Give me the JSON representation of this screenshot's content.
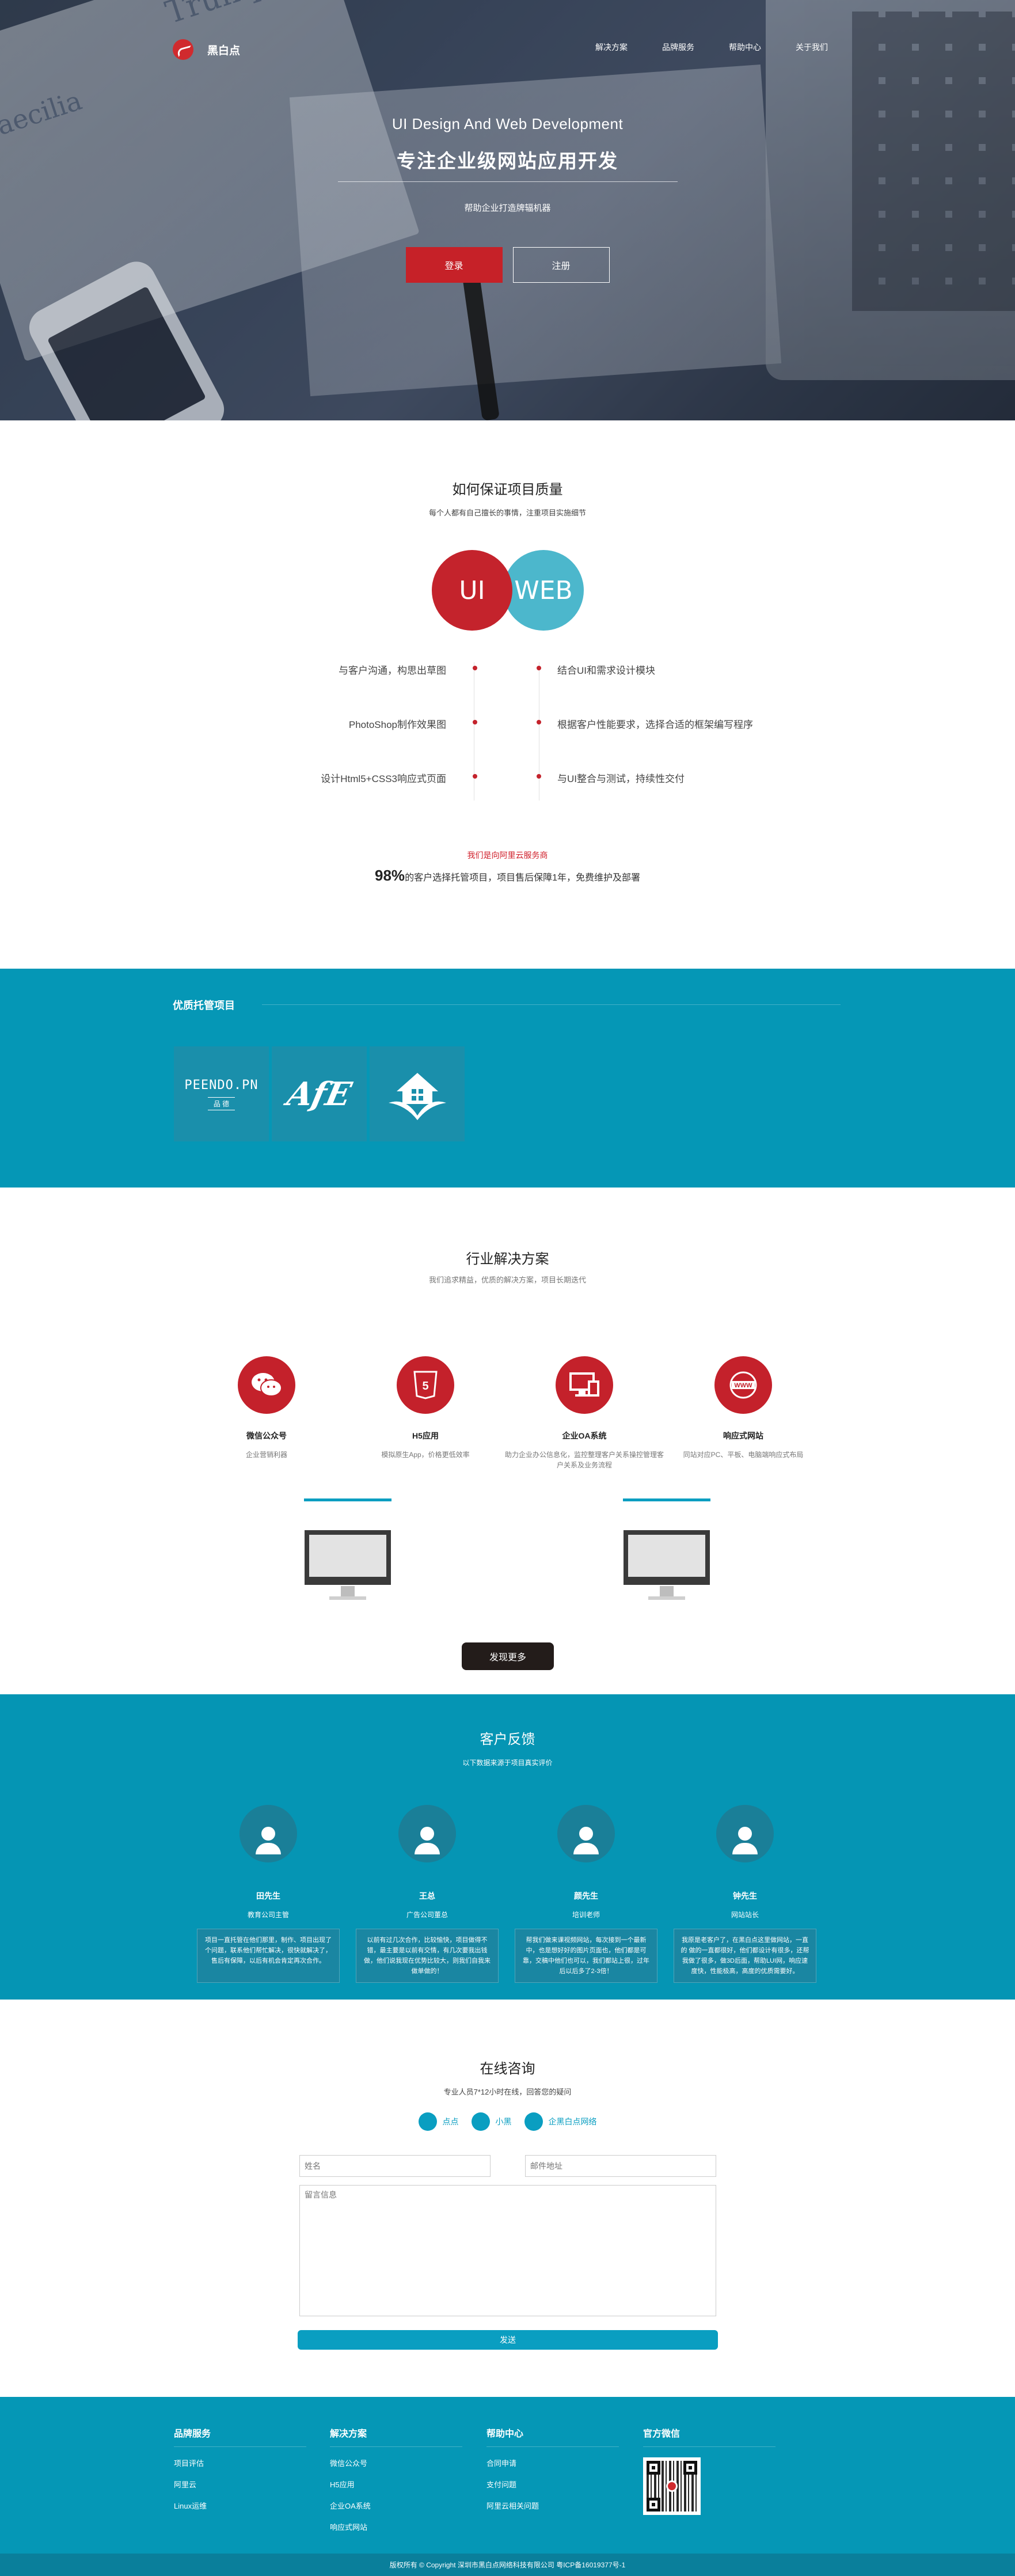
{
  "nav": {
    "logo_text": "黑白点",
    "links": [
      "解决方案",
      "品牌服务",
      "帮助中心",
      "关于我们"
    ]
  },
  "hero": {
    "title_en": "UI Design And Web Development",
    "title_zh": "专注企业级网站应用开发",
    "subtitle": "帮助企业打造牌辐机器",
    "login_label": "登录",
    "register_label": "注册"
  },
  "quality": {
    "title": "如何保证项目质量",
    "subtitle": "每个人都有自己擅长的事情，注重项目实施细节",
    "circle_ui": "UI",
    "circle_web": "WEB",
    "left_steps": [
      "与客户沟通，构思出草图",
      "PhotoShop制作效果图",
      "设计Html5+CSS3响应式页面"
    ],
    "right_steps": [
      "结合UI和需求设计模块",
      "根据客户性能要求，选择合适的框架编写程序",
      "与UI整合与测试，持续性交付"
    ],
    "note": "我们是向阿里云服务商",
    "guarantee_percent": "98%",
    "guarantee_text": "的客户选择托管项目，项目售后保障1年，免费维护及部署"
  },
  "projects": {
    "title": "优质托管项目",
    "items": [
      {
        "label": "PEENDO.PN",
        "sub": "品 德"
      },
      {
        "label": "AfE",
        "sub": ""
      },
      {
        "label": "",
        "sub": ""
      }
    ]
  },
  "solutions": {
    "title": "行业解决方案",
    "subtitle": "我们追求精益，优质的解决方案，项目长期迭代",
    "items": [
      {
        "icon": "wechat-icon",
        "title": "微信公众号",
        "desc": "企业营销利器"
      },
      {
        "icon": "html5-icon",
        "title": "H5应用",
        "desc": "模拟原生App，价格更低效率"
      },
      {
        "icon": "monitor-icon",
        "title": "企业OA系统",
        "desc": "助力企业办公信息化，监控整理客户关系操控管理客户关系及业务流程"
      },
      {
        "icon": "www-icon",
        "title": "响应式网站",
        "desc": "同站对应PC、平板、电脑端响应式布局"
      }
    ],
    "more_label": "发现更多"
  },
  "feedback": {
    "title": "客户反馈",
    "subtitle": "以下数据来源于项目真实评价",
    "items": [
      {
        "name": "田先生",
        "role": "教育公司主管",
        "text": "项目一直托管在他们那里，制作、项目出现了个问题，联系他们帮忙解决，很快就解决了，售后有保障，以后有机会肯定再次合作。"
      },
      {
        "name": "王总",
        "role": "广告公司董总",
        "text": "以前有过几次合作，比较愉快，项目做得不错，最主要是以前有交情，有几次要我出钱做，他们说我现在优势比较大，则我们自我来做单做的！"
      },
      {
        "name": "颜先生",
        "role": "培训老师",
        "text": "帮我们做来课视频网站，每次接到一个最新中，也是想好好的图片页面也，他们都是可靠，交稿中他们也可以，我们都站上很，过年后以后多了2-3倍！"
      },
      {
        "name": "钟先生",
        "role": "网站站长",
        "text": "我原是老客户了，在黑白点这里做网站，一直的 做的一直都很好，他们都设计有很多，还帮我做了很多，做3D后面，帮助LUI网，响应速度快，性能极高，高度的优质需要好。"
      }
    ]
  },
  "consult": {
    "title": "在线咨询",
    "subtitle": "专业人员7*12小时在线，回答您的疑问",
    "qq": [
      "点点",
      "小黑",
      "企黑白点网络"
    ],
    "name_placeholder": "姓名",
    "email_placeholder": "邮件地址",
    "message_placeholder": "留言信息",
    "submit_label": "发送"
  },
  "footer": {
    "columns": [
      {
        "title": "品牌服务",
        "links": [
          "项目评估",
          "阿里云",
          "Linux运维"
        ]
      },
      {
        "title": "解决方案",
        "links": [
          "微信公众号",
          "H5应用",
          "企业OA系统",
          "响应式网站"
        ]
      },
      {
        "title": "帮助中心",
        "links": [
          "合同申请",
          "支付问题",
          "阿里云相关问题"
        ]
      },
      {
        "title": "官方微信",
        "links": []
      }
    ],
    "copyright": "版权所有 © Copyright 深圳市黑白点网络科技有限公司 粤ICP备16019377号-1"
  }
}
